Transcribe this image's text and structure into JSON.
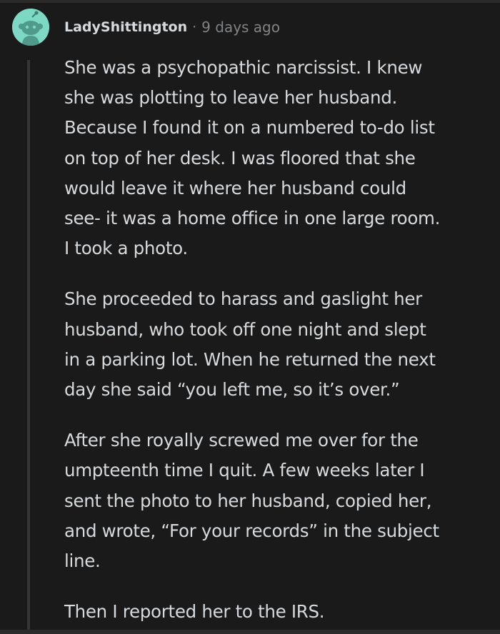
{
  "comment": {
    "username": "LadyShittington",
    "separator": "·",
    "timestamp": "9 days ago",
    "avatar_icon": "snoo-avatar-icon",
    "colors": {
      "background": "#1a1a1b",
      "text": "#d7dadc",
      "muted": "#818384",
      "avatar": "#7ed9c4",
      "thread_line": "#343536"
    },
    "paragraphs": [
      {
        "lines": [
          "She was a psychopathic narcissist. I knew",
          "she was plotting to leave her husband.",
          "Because I found it on a numbered to-do list",
          "on top of her desk. I was floored that she",
          "would leave it where her husband could",
          "see- it was a home office in one large room.",
          "I took a photo."
        ]
      },
      {
        "lines": [
          "She proceeded to harass and gaslight her",
          "husband, who took off one night and slept",
          "in a parking lot. When he returned the next",
          "day she said “you left me, so it’s over.”"
        ]
      },
      {
        "lines": [
          "After she royally screwed me over for the",
          "umpteenth time I quit. A few weeks later I",
          "sent the photo to her husband, copied her,",
          "and wrote, “For your records” in the subject",
          "line."
        ]
      },
      {
        "lines": [
          "Then I reported her to the IRS."
        ]
      }
    ]
  }
}
